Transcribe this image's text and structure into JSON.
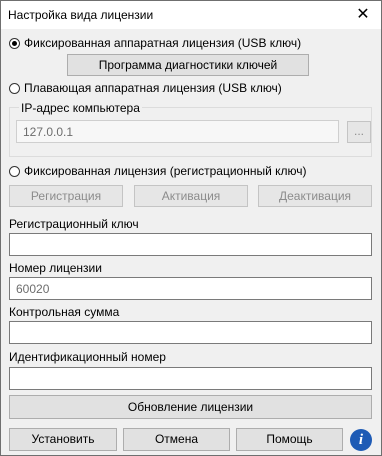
{
  "window": {
    "title": "Настройка вида лицензии",
    "close_glyph": "✕"
  },
  "options": {
    "usb_fixed": {
      "label": "Фиксированная аппаратная лицензия (USB ключ)",
      "checked": true
    },
    "diag_button": "Программа диагностики ключей",
    "usb_floating": {
      "label": "Плавающая аппаратная лицензия (USB ключ)",
      "checked": false
    },
    "ip_group": {
      "label": "IP-адрес компьютера",
      "value": "127.0.0.1",
      "browse": "..."
    },
    "fixed_reg": {
      "label": "Фиксированная лицензия (регистрационный ключ)",
      "checked": false
    }
  },
  "reg_buttons": {
    "register": "Регистрация",
    "activate": "Активация",
    "deactivate": "Деактивация"
  },
  "fields": {
    "reg_key": {
      "label": "Регистрационный ключ",
      "value": ""
    },
    "license_number": {
      "label": "Номер лицензии",
      "value": "60020"
    },
    "checksum": {
      "label": "Контрольная сумма",
      "value": ""
    },
    "id_number": {
      "label": "Идентификационный номер",
      "value": ""
    }
  },
  "update_button": "Обновление лицензии",
  "footer": {
    "install": "Установить",
    "cancel": "Отмена",
    "help": "Помощь",
    "info_glyph": "i"
  },
  "colors": {
    "info_icon": "#1e5bb5",
    "window_bg": "#f0f0f0"
  }
}
